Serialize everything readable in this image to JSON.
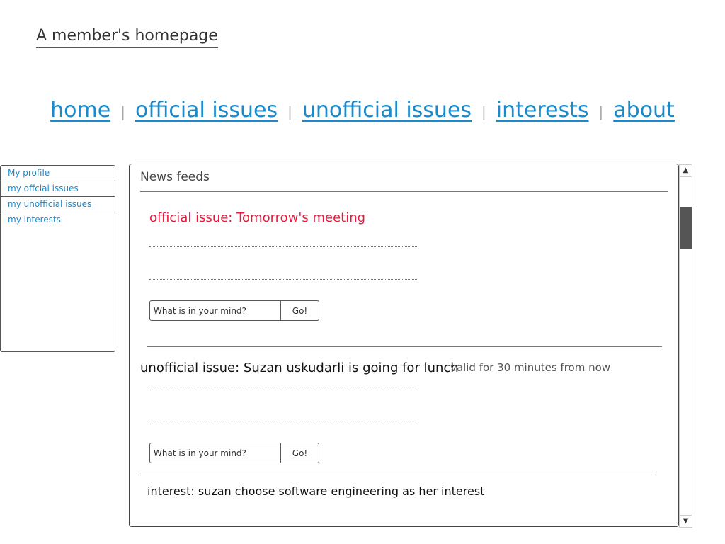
{
  "page": {
    "title": "A member's homepage"
  },
  "nav": {
    "home": "home",
    "official_issues": "official issues",
    "unofficial_issues": "unofficial issues",
    "interests": "interests",
    "about": "about",
    "separator": "|"
  },
  "sidebar": {
    "items": [
      {
        "label": "My profile"
      },
      {
        "label": "my offcial issues"
      },
      {
        "label": "my unofficial issues"
      },
      {
        "label": "my interests"
      }
    ]
  },
  "feed": {
    "header": "News feeds",
    "posts": [
      {
        "title": "official issue: Tomorrow's meeting",
        "comment_placeholder": "What is in your mind?",
        "go_label": "Go!"
      },
      {
        "title": "unofficial issue: Suzan uskudarli is going for lunch",
        "validity": "valid for 30 minutes from now",
        "comment_placeholder": "What is in your mind?",
        "go_label": "Go!"
      },
      {
        "title": "interest: suzan choose software engineering as her interest"
      }
    ]
  },
  "scrollbar": {
    "up_icon": "▲",
    "down_icon": "▼",
    "position": 0.12
  },
  "colors": {
    "link": "#1a8acb",
    "official_issue": "#e8193c"
  }
}
